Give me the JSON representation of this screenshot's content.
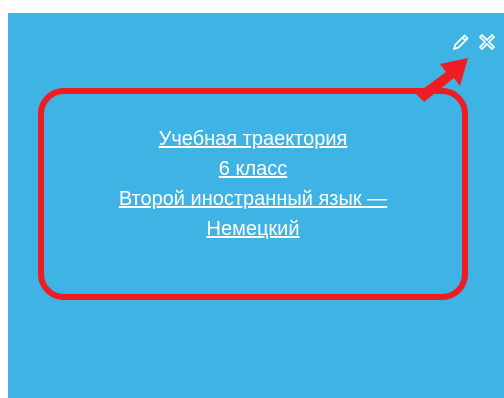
{
  "tile": {
    "background": "#3fb3e3",
    "link_lines": [
      "Учебная траектория",
      "6 класс",
      "Второй иностранный язык —",
      "Немецкий"
    ],
    "actions": [
      {
        "icon": "pencil-icon",
        "purpose": "edit"
      },
      {
        "icon": "close-icon",
        "purpose": "delete"
      }
    ]
  },
  "annotation": {
    "frame_color": "#ee1d23",
    "arrow_color": "#ee1d23",
    "arrow_icon": "arrow-icon"
  }
}
